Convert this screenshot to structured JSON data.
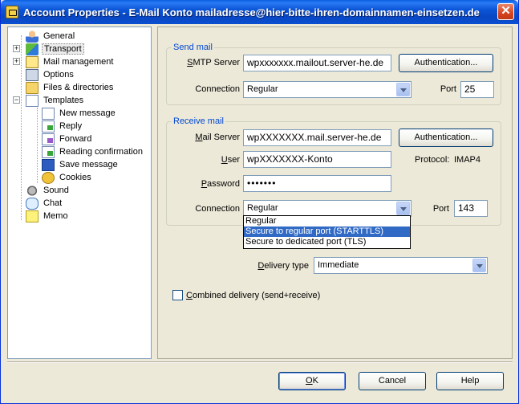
{
  "window": {
    "title": "Account Properties - E-Mail Konto mailadresse@hier-bitte-ihren-domainnamen-einsetzen.de",
    "close_glyph": "✕"
  },
  "tree": {
    "items": [
      {
        "label": "General",
        "icon": "user-icon"
      },
      {
        "label": "Transport",
        "icon": "transport-icon"
      },
      {
        "label": "Mail management",
        "icon": "mail-icon"
      },
      {
        "label": "Options",
        "icon": "options-icon"
      },
      {
        "label": "Files & directories",
        "icon": "folder-icon"
      },
      {
        "label": "Templates",
        "icon": "templates-icon"
      },
      {
        "label": "New message",
        "icon": "document-icon"
      },
      {
        "label": "Reply",
        "icon": "reply-icon"
      },
      {
        "label": "Forward",
        "icon": "forward-icon"
      },
      {
        "label": "Reading confirmation",
        "icon": "confirmation-icon"
      },
      {
        "label": "Save message",
        "icon": "floppy-icon"
      },
      {
        "label": "Cookies",
        "icon": "cookie-icon"
      },
      {
        "label": "Sound",
        "icon": "speaker-icon"
      },
      {
        "label": "Chat",
        "icon": "chat-bubble-icon"
      },
      {
        "label": "Memo",
        "icon": "memo-icon"
      }
    ],
    "expander_plus": "+",
    "expander_minus": "−"
  },
  "send_mail": {
    "legend": "Send mail",
    "smtp_label_pre": "",
    "smtp_label_u": "S",
    "smtp_label_post": "MTP Server",
    "smtp_value": "wpxxxxxxx.mailout.server-he.de",
    "auth_button": "Authentication...",
    "connection_label": "Connection",
    "connection_value": "Regular",
    "port_label": "Port",
    "port_value": "25"
  },
  "receive_mail": {
    "legend": "Receive mail",
    "server_label_u": "M",
    "server_label_post": "ail Server",
    "server_value": "wpXXXXXXX.mail.server-he.de",
    "auth_button": "Authentication...",
    "user_label_u": "U",
    "user_label_post": "ser",
    "user_value": "wpXXXXXXX-Konto",
    "protocol_label": "Protocol:",
    "protocol_value": "IMAP4",
    "password_label_u": "P",
    "password_label_post": "assword",
    "password_value": "•••••••",
    "connection_label": "Connection",
    "connection_value": "Regular",
    "port_label": "Port",
    "port_value": "143",
    "connection_options": [
      "Regular",
      "Secure to regular port (STARTTLS)",
      "Secure to dedicated port (TLS)"
    ]
  },
  "delivery": {
    "label_u": "D",
    "label_post": "elivery type",
    "value": "Immediate"
  },
  "combined": {
    "label_u": "C",
    "label_post": "ombined delivery (send+receive)"
  },
  "buttons": {
    "ok_u": "O",
    "ok_post": "K",
    "cancel": "Cancel",
    "help": "Help"
  },
  "colors": {
    "titlebar": "#0b55d6",
    "legend": "#0046d5",
    "highlight": "#316ac5"
  }
}
